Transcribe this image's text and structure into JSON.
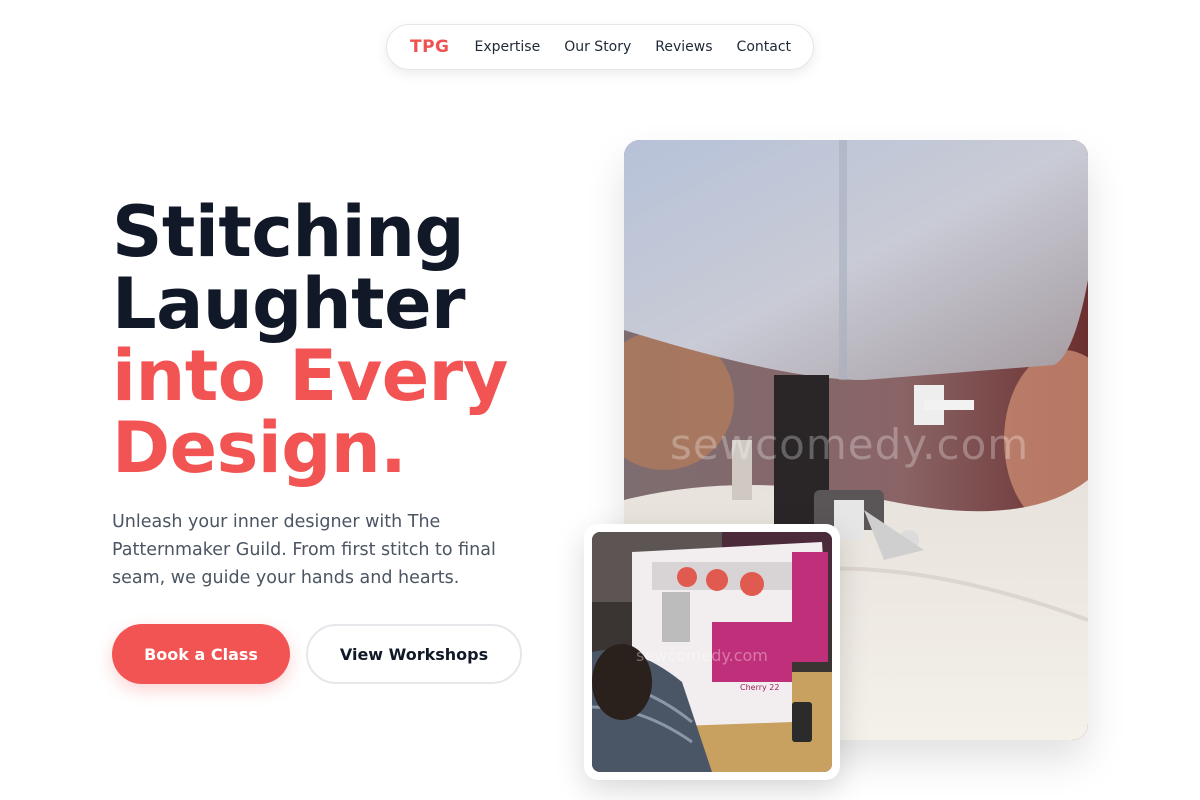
{
  "nav": {
    "logo": "TPG",
    "links": [
      "Expertise",
      "Our Story",
      "Reviews",
      "Contact"
    ]
  },
  "hero": {
    "headline_line1": "Stitching",
    "headline_line2": "Laughter",
    "headline_line3": "into Every",
    "headline_line4": "Design.",
    "lead": "Unleash your inner designer with The Patternmaker Guild. From first stitch to final seam, we guide your hands and hearts.",
    "primary_cta": "Book a Class",
    "secondary_cta": "View Workshops"
  },
  "images": {
    "main_watermark": "sewcomedy.com",
    "small_watermark": "sewcomedy.com",
    "small_machine_brand": "Cherry 22"
  },
  "colors": {
    "accent": "#f25454",
    "heading": "#111827",
    "body_text": "#4b5563"
  }
}
